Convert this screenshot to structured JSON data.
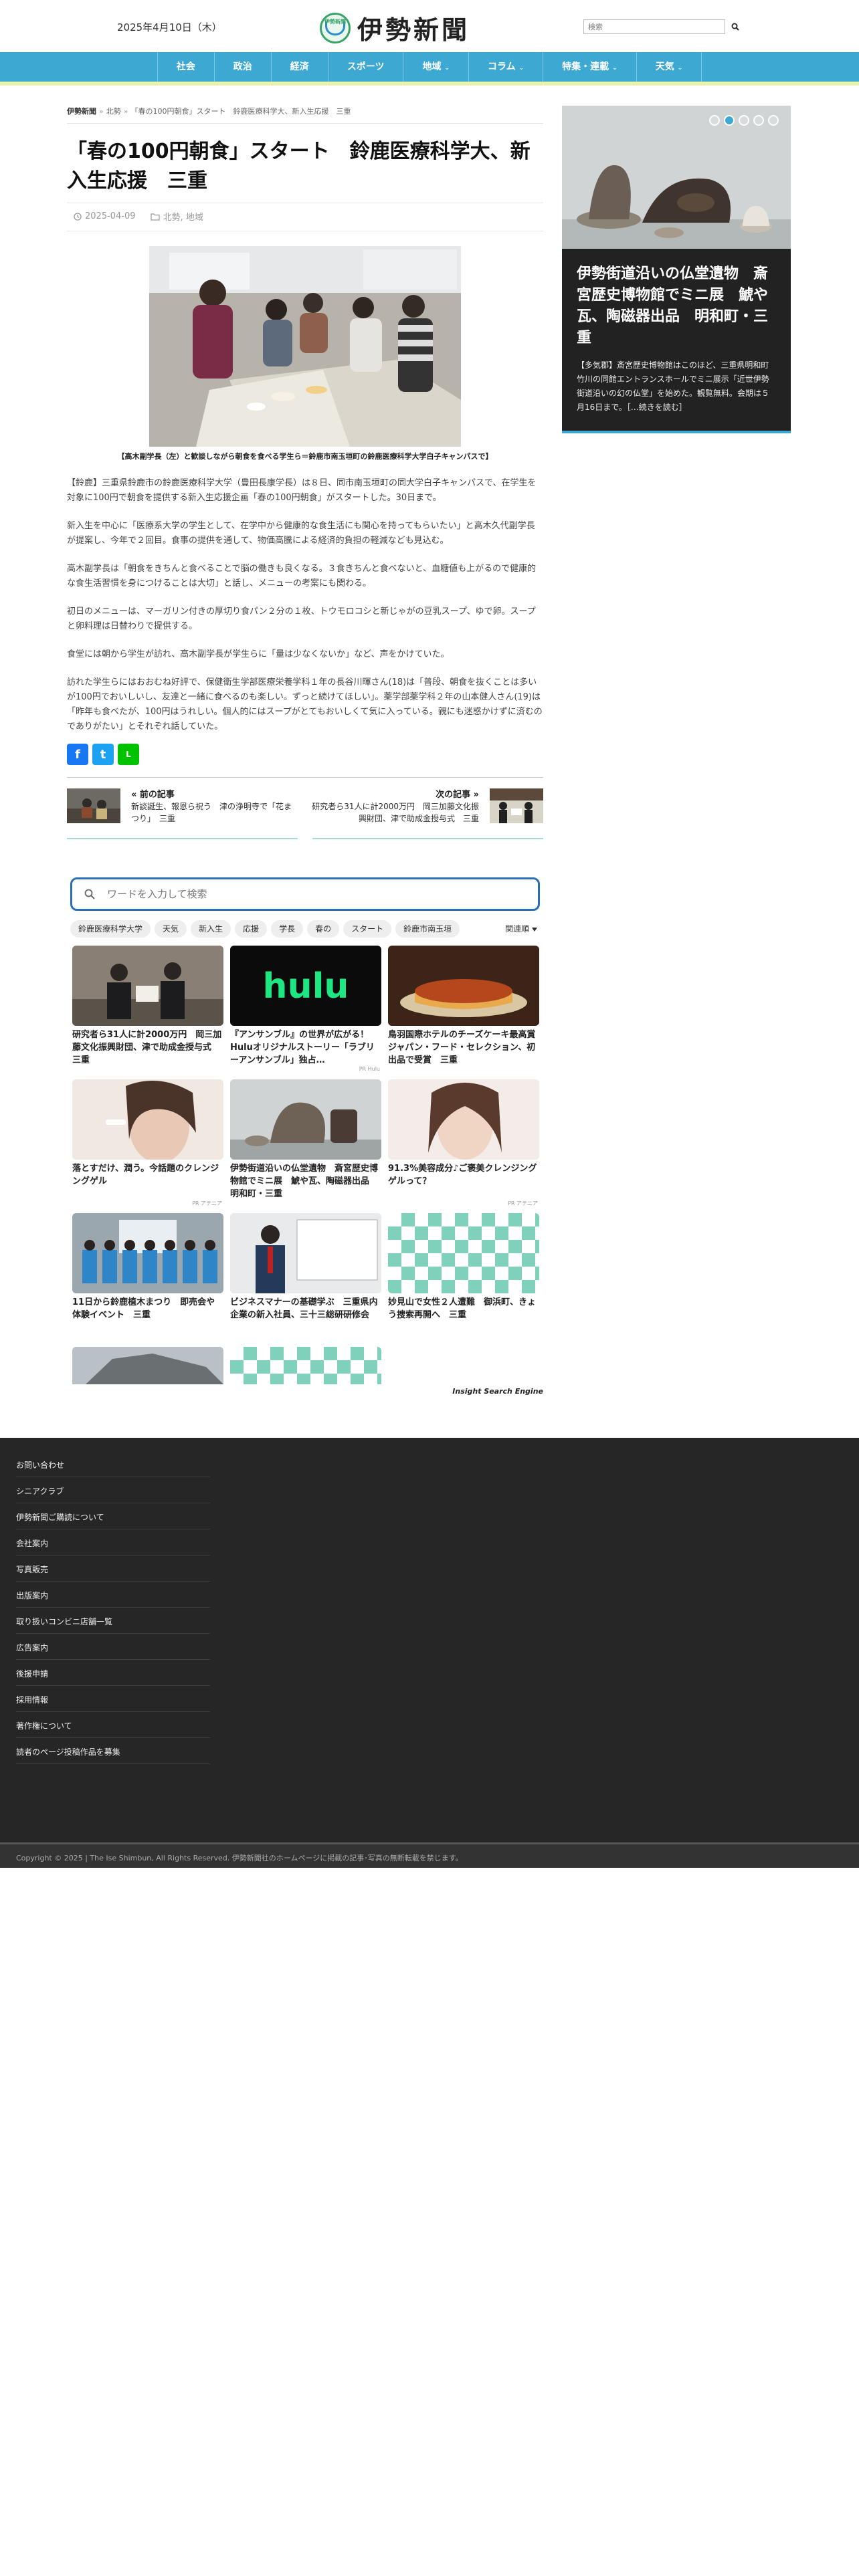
{
  "header": {
    "date": "2025年4月10日（木）",
    "logo_emblem": "伊勢新聞",
    "logo_text": "伊勢新聞",
    "search_placeholder": "検索"
  },
  "nav": {
    "items": [
      {
        "label": "社会",
        "has_dropdown": false
      },
      {
        "label": "政治",
        "has_dropdown": false
      },
      {
        "label": "経済",
        "has_dropdown": false
      },
      {
        "label": "スポーツ",
        "has_dropdown": false
      },
      {
        "label": "地域",
        "has_dropdown": true
      },
      {
        "label": "コラム",
        "has_dropdown": true
      },
      {
        "label": "特集・連載",
        "has_dropdown": true
      },
      {
        "label": "天気",
        "has_dropdown": true
      }
    ],
    "caret": "⌄"
  },
  "breadcrumb": {
    "home": "伊勢新聞",
    "category": "北勢",
    "current": "「春の100円朝食」スタート　鈴鹿医療科学大、新入生応援　三重",
    "separator": "»"
  },
  "article": {
    "title": "「春の100円朝食」スタート　鈴鹿医療科学大、新入生応援　三重",
    "date": "2025-04-09",
    "categories": "北勢, 地域",
    "caption": "【高木副学長（左）と歓談しながら朝食を食べる学生ら＝鈴鹿市南玉垣町の鈴鹿医療科学大学白子キャンパスで】",
    "paragraphs": [
      "【鈴鹿】三重県鈴鹿市の鈴鹿医療科学大学（豊田長康学長）は８日、同市南玉垣町の同大学白子キャンパスで、在学生を対象に100円で朝食を提供する新入生応援企画「春の100円朝食」がスタートした。30日まで。",
      "新入生を中心に「医療系大学の学生として、在学中から健康的な食生活にも関心を持ってもらいたい」と高木久代副学長が提案し、今年で２回目。食事の提供を通して、物価高騰による経済的負担の軽減なども見込む。",
      "高木副学長は「朝食をきちんと食べることで脳の働きも良くなる。３食きちんと食べないと、血糖値も上がるので健康的な食生活習慣を身につけることは大切」と話し、メニューの考案にも関わる。",
      "初日のメニューは、マーガリン付きの厚切り食パン２分の１枚、トウモロコシと新じゃがの豆乳スープ、ゆで卵。スープと卵料理は日替わりで提供する。",
      "食堂には朝から学生が訪れ、高木副学長が学生らに「量は少なくないか」など、声をかけていた。",
      "訪れた学生らにはおおむね好評で、保健衛生学部医療栄養学科１年の長谷川暉さん(18)は「普段、朝食を抜くことは多いが100円でおいしいし、友達と一緒に食べるのも楽しい。ずっと続けてほしい」。薬学部薬学科２年の山本健人さん(19)は「昨年も食べたが、100円はうれしい。個人的にはスープがとてもおいしくて気に入っている。親にも迷惑かけずに済むのでありがたい」とそれぞれ話していた。"
    ]
  },
  "share": {
    "facebook": "f",
    "twitter": "t",
    "line": "L"
  },
  "post_nav": {
    "prev_label": "« 前の記事",
    "prev_title": "新談誕生、報恩ら祝う　津の浄明寺で「花まつり」　三重",
    "next_label": "次の記事 »",
    "next_title": "研究者ら31人に計2000万円　岡三加藤文化振興財団、津で助成金授与式　三重"
  },
  "search_engine": {
    "placeholder": "ワードを入力して検索",
    "tags": [
      "鈴鹿医療科学大学",
      "天気",
      "新入生",
      "応援",
      "学長",
      "春の",
      "スタート",
      "鈴鹿市南玉垣"
    ],
    "sort_label": "関連順",
    "brand": "Insight Search Engine",
    "cards": [
      {
        "title": "研究者ら31人に計2000万円　岡三加藤文化振興財団、津で助成金授与式　三重",
        "ad": ""
      },
      {
        "title": "『アンサンブル』の世界が広がる！Huluオリジナルストーリー「ラブリーアンサンブル」独占…",
        "ad": "PR Hulu"
      },
      {
        "title": "鳥羽国際ホテルのチーズケーキ最高賞　ジャパン・フード・セレクション、初出品で受賞　三重",
        "ad": ""
      },
      {
        "title": "落とすだけ、潤う。今話題のクレンジングゲル",
        "ad": "PR アテニア"
      },
      {
        "title": "伊勢街道沿いの仏堂遺物　斎宮歴史博物館でミニ展　鯱や瓦、陶磁器出品　明和町・三重",
        "ad": ""
      },
      {
        "title": "91.3%美容成分♪ご褒美クレンジングゲルって？",
        "ad": "PR アテニア"
      },
      {
        "title": "11日から鈴鹿植木まつり　即売会や体験イベント　三重",
        "ad": ""
      },
      {
        "title": "ビジネスマナーの基礎学ぶ　三重県内企業の新入社員、三十三総研研修会",
        "ad": ""
      },
      {
        "title": "妙見山で女性２人遭難　御浜町、きょう捜索再開へ　三重",
        "ad": ""
      }
    ]
  },
  "sidebar": {
    "slide_title": "伊勢街道沿いの仏堂遺物　斎宮歴史博物館でミニ展　鯱や瓦、陶磁器出品　明和町・三重",
    "slide_text": "【多気郡】斎宮歴史博物館はこのほど、三重県明和町竹川の同館エントランスホールでミニ展示「近世伊勢街道沿いの幻の仏堂」を始めた。観覧無料。会期は５月16日まで。［…続きを読む］"
  },
  "footer": {
    "links": [
      "お問い合わせ",
      "シニアクラブ",
      "伊勢新聞ご購読について",
      "会社案内",
      "写真販売",
      "出版案内",
      "取り扱いコンビニ店舗一覧",
      "広告案内",
      "後援申請",
      "採用情報",
      "著作権について",
      "読者のページ投稿作品を募集"
    ],
    "copyright": "Copyright © 2025 | The Ise Shimbun, All Rights Reserved. 伊勢新聞社のホームページに掲載の記事･写真の無断転載を禁じます。"
  },
  "colors": {
    "nav_bg": "#3da9d3",
    "accent_green": "#a9dbd0",
    "search_border": "#2a6fb5",
    "footer_bg": "#262626"
  }
}
